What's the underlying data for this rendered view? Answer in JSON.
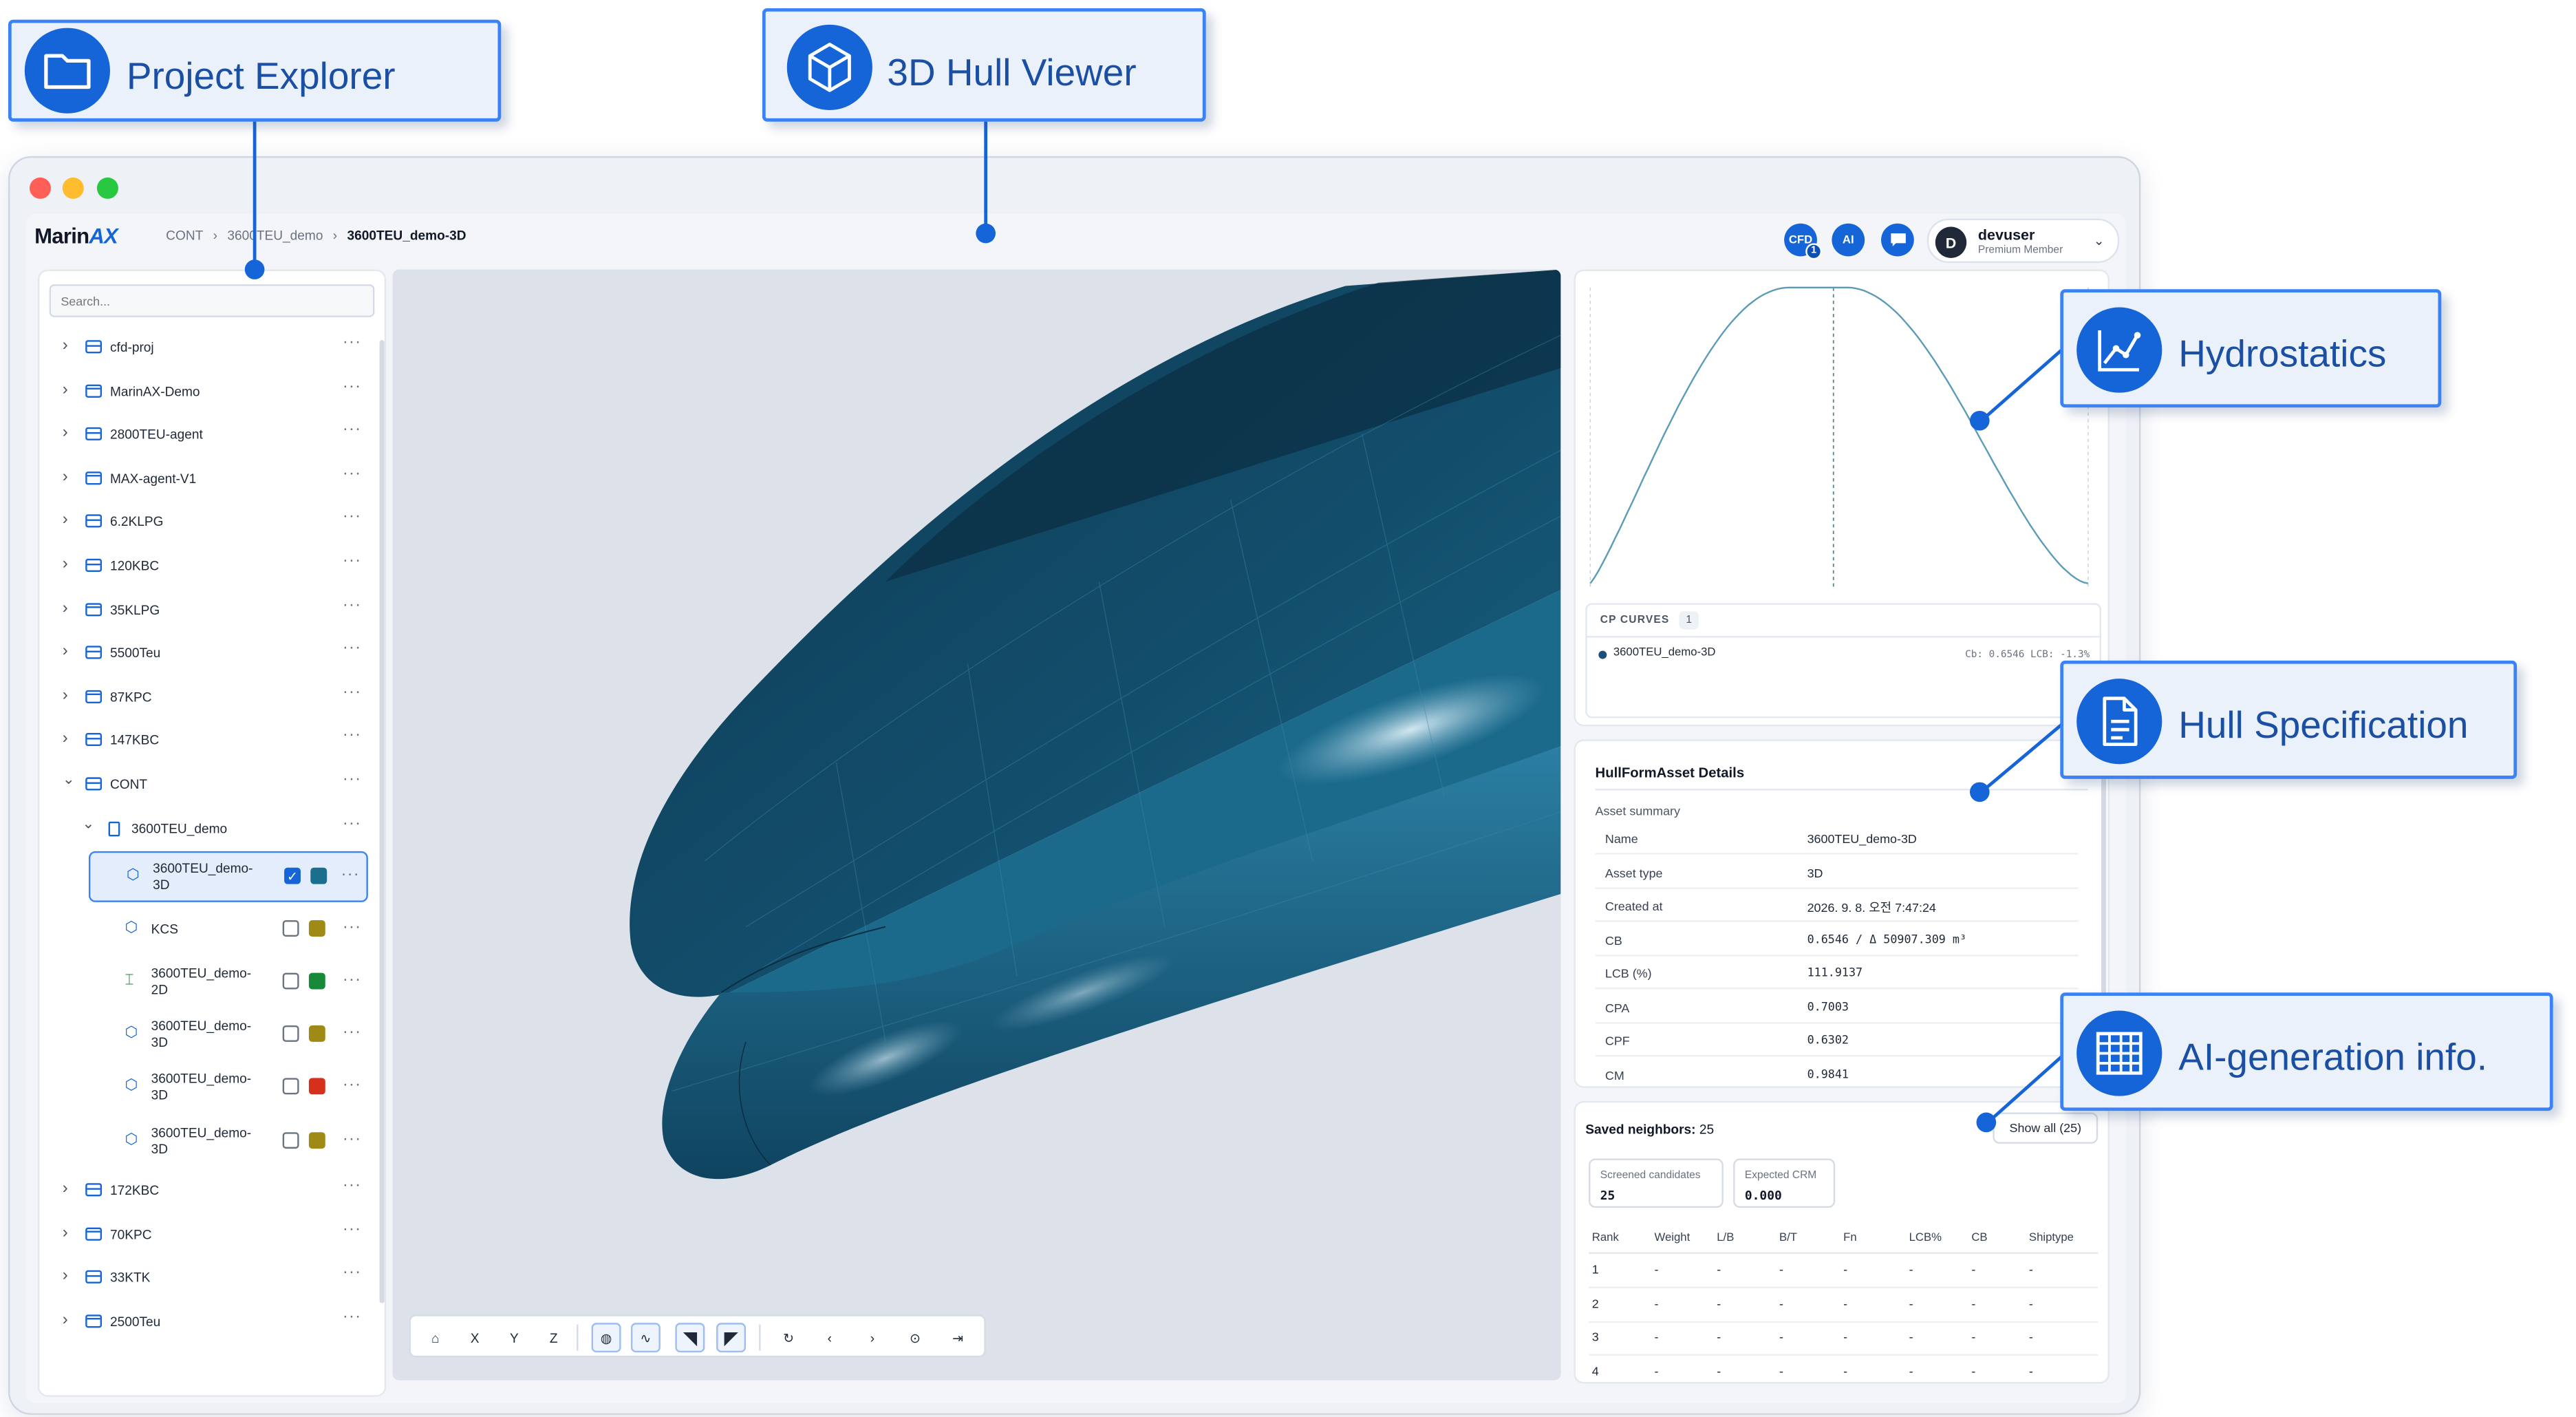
{
  "callouts": {
    "project_explorer": "Project Explorer",
    "hull_viewer": "3D Hull Viewer",
    "hydrostatics": "Hydrostatics",
    "hull_spec": "Hull Specification",
    "ai_info": "AI-generation info."
  },
  "header": {
    "logo_main": "Marin",
    "logo_accent": "AX",
    "breadcrumb": [
      "CONT",
      "3600TEU_demo",
      "3600TEU_demo-3D"
    ],
    "icons": {
      "cfd": "CFD",
      "cfd_badge": "1",
      "ai": "AI"
    },
    "user": {
      "initial": "D",
      "name": "devuser",
      "role": "Premium Member"
    }
  },
  "sidebar": {
    "search_placeholder": "Search...",
    "projects_top": [
      "cfd-proj",
      "MarinAX-Demo",
      "2800TEU-agent",
      "MAX-agent-V1",
      "6.2KLPG",
      "120KBC",
      "35KLPG",
      "5500Teu",
      "87KPC",
      "147KBC",
      "CONT"
    ],
    "subfolder": "3600TEU_demo",
    "assets": [
      {
        "l1": "3600TEU_demo-",
        "l2": "3D",
        "checked": true,
        "color": "#1a6f8f",
        "icon": "cube-icon"
      },
      {
        "l1": "KCS",
        "l2": "",
        "checked": false,
        "color": "#a08a16",
        "icon": "cube-icon"
      },
      {
        "l1": "3600TEU_demo-",
        "l2": "2D",
        "checked": false,
        "color": "#178a3a",
        "icon": "section-icon"
      },
      {
        "l1": "3600TEU_demo-",
        "l2": "3D",
        "checked": false,
        "color": "#a08a16",
        "icon": "cube-icon"
      },
      {
        "l1": "3600TEU_demo-",
        "l2": "3D",
        "checked": false,
        "color": "#d6301c",
        "icon": "cube-icon"
      },
      {
        "l1": "3600TEU_demo-",
        "l2": "3D",
        "checked": false,
        "color": "#a08a16",
        "icon": "cube-icon"
      }
    ],
    "projects_bottom": [
      "172KBC",
      "70KPC",
      "33KTK",
      "2500Teu"
    ]
  },
  "viewer": {
    "toolbar": [
      "home-icon",
      "X",
      "Y",
      "Z",
      "shade-icon",
      "wire-icon",
      "profile-view-icon",
      "section-view-icon",
      "rotate-icon",
      "prev-icon",
      "next-icon",
      "target-icon",
      "exit-icon"
    ]
  },
  "cp": {
    "title": "CP CURVES",
    "count": "1",
    "entry": "3600TEU_demo-3D",
    "stats": "Cb: 0.6546  LCB: -1.3%",
    "line_color": "#5b9bb8"
  },
  "details": {
    "title": "HullFormAsset Details",
    "subtitle": "Asset summary",
    "rows": [
      {
        "k": "Name",
        "v": "3600TEU_demo-3D"
      },
      {
        "k": "Asset type",
        "v": "3D"
      },
      {
        "k": "Created at",
        "v": "2026. 9. 8. 오전 7:47:24"
      },
      {
        "k": "CB",
        "v": "0.6546 / Δ 50907.309 m³"
      },
      {
        "k": "LCB (%)",
        "v": "111.9137"
      },
      {
        "k": "CPA",
        "v": "0.7003"
      },
      {
        "k": "CPF",
        "v": "0.6302"
      },
      {
        "k": "CM",
        "v": "0.9841"
      }
    ]
  },
  "neighbors": {
    "title_label": "Saved neighbors:",
    "title_count": "25",
    "show_all": "Show all (25)",
    "cards": [
      {
        "label": "Screened candidates",
        "value": "25"
      },
      {
        "label": "Expected CRM",
        "value": "0.000"
      }
    ],
    "columns": [
      "Rank",
      "Weight",
      "L/B",
      "B/T",
      "Fn",
      "LCB%",
      "CB",
      "Shiptype"
    ],
    "rows": [
      [
        "1",
        "-",
        "-",
        "-",
        "-",
        "-",
        "-",
        "-"
      ],
      [
        "2",
        "-",
        "-",
        "-",
        "-",
        "-",
        "-",
        "-"
      ],
      [
        "3",
        "-",
        "-",
        "-",
        "-",
        "-",
        "-",
        "-"
      ],
      [
        "4",
        "-",
        "-",
        "-",
        "-",
        "-",
        "-",
        "-"
      ]
    ]
  },
  "colors": {
    "accent": "#1565d8",
    "hull": "#14506b"
  }
}
